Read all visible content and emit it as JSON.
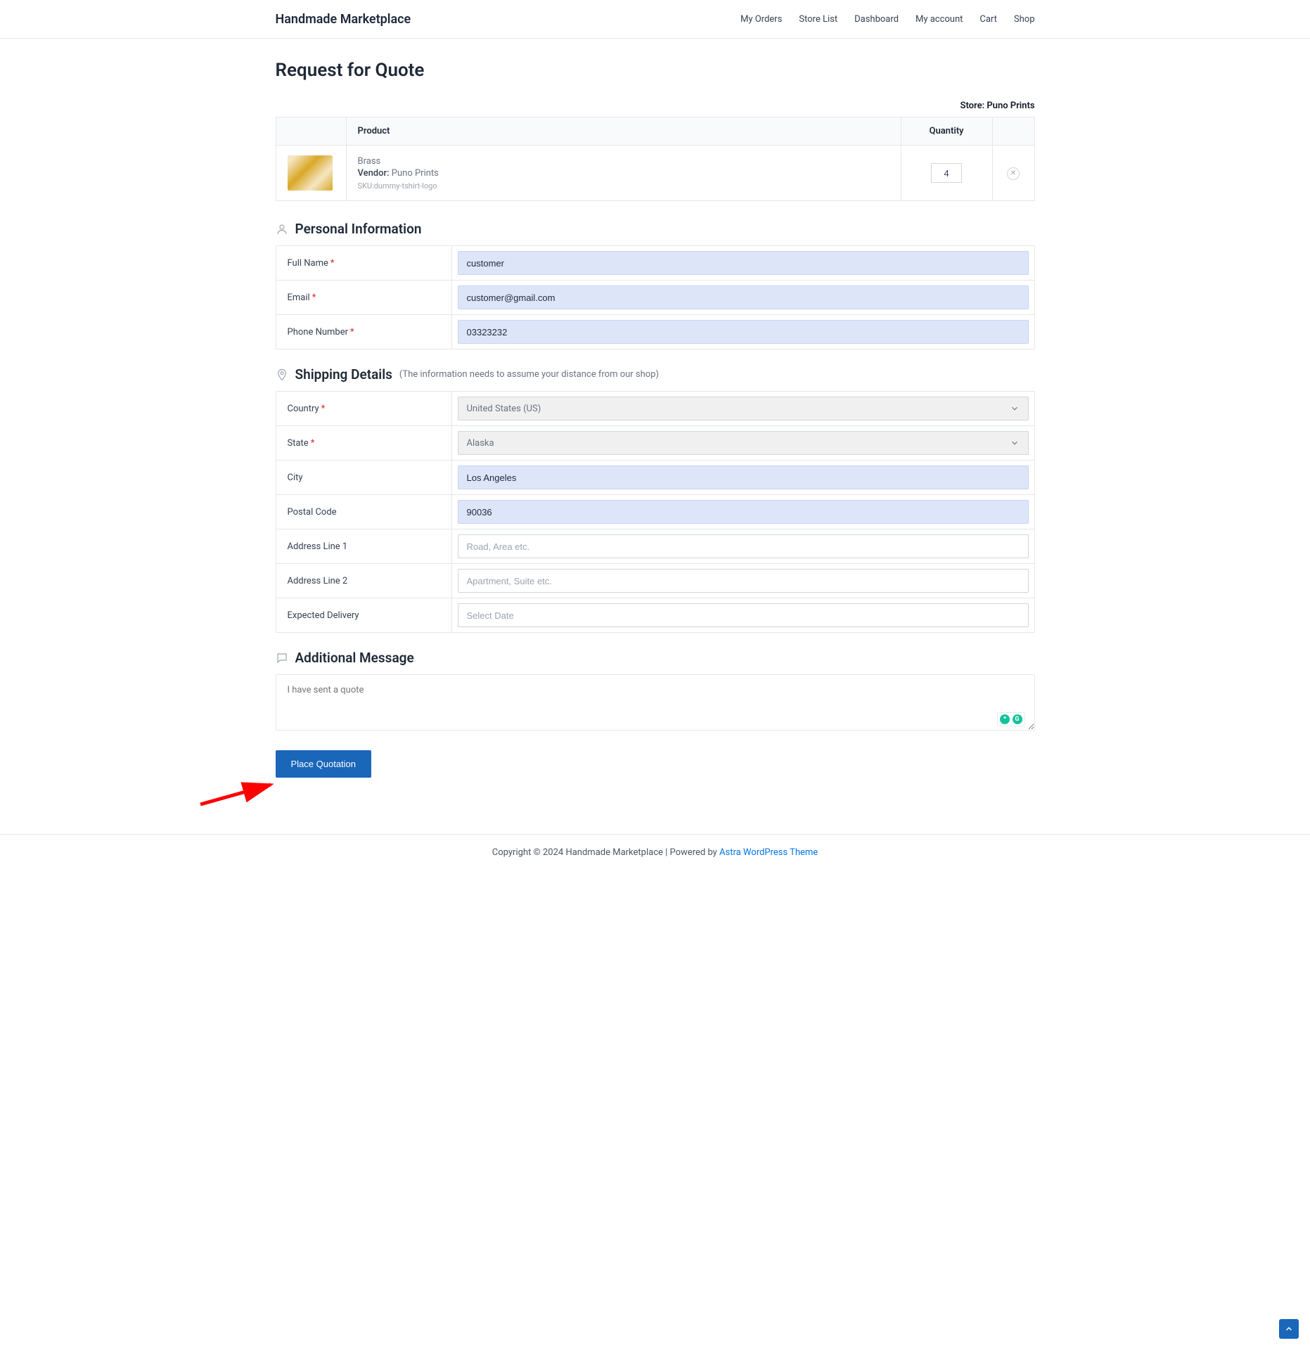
{
  "brand": "Handmade Marketplace",
  "nav": {
    "my_orders": "My Orders",
    "store_list": "Store List",
    "dashboard": "Dashboard",
    "my_account": "My account",
    "cart": "Cart",
    "shop": "Shop"
  },
  "page_title": "Request for Quote",
  "store_label": "Store: ",
  "store_name": "Puno Prints",
  "table": {
    "col_product": "Product",
    "col_qty": "Quantity",
    "item": {
      "name": "Brass",
      "vendor_label": "Vendor:",
      "vendor_name": "Puno Prints",
      "sku": "SKU:dummy-tshirt-logo",
      "qty": "4"
    }
  },
  "sections": {
    "personal": "Personal Information",
    "shipping": "Shipping Details",
    "shipping_hint": "(The information needs to assume your distance from our shop)",
    "message": "Additional Message"
  },
  "personal": {
    "full_name_label": "Full Name",
    "full_name_value": "customer",
    "email_label": "Email",
    "email_value": "customer@gmail.com",
    "phone_label": "Phone Number",
    "phone_value": "03323232"
  },
  "shipping": {
    "country_label": "Country",
    "country_value": "United States (US)",
    "state_label": "State",
    "state_value": "Alaska",
    "city_label": "City",
    "city_value": "Los Angeles",
    "postal_label": "Postal Code",
    "postal_value": "90036",
    "addr1_label": "Address Line 1",
    "addr1_placeholder": "Road, Area etc.",
    "addr2_label": "Address Line 2",
    "addr2_placeholder": "Apartment, Suite etc.",
    "expected_label": "Expected Delivery",
    "expected_placeholder": "Select Date"
  },
  "message_placeholder": "I have sent a quote",
  "place_btn": "Place Quotation",
  "footer": {
    "text": "Copyright © 2024 Handmade Marketplace | Powered by ",
    "link": "Astra WordPress Theme"
  },
  "required_marker": "*",
  "grammarly_g": "G"
}
